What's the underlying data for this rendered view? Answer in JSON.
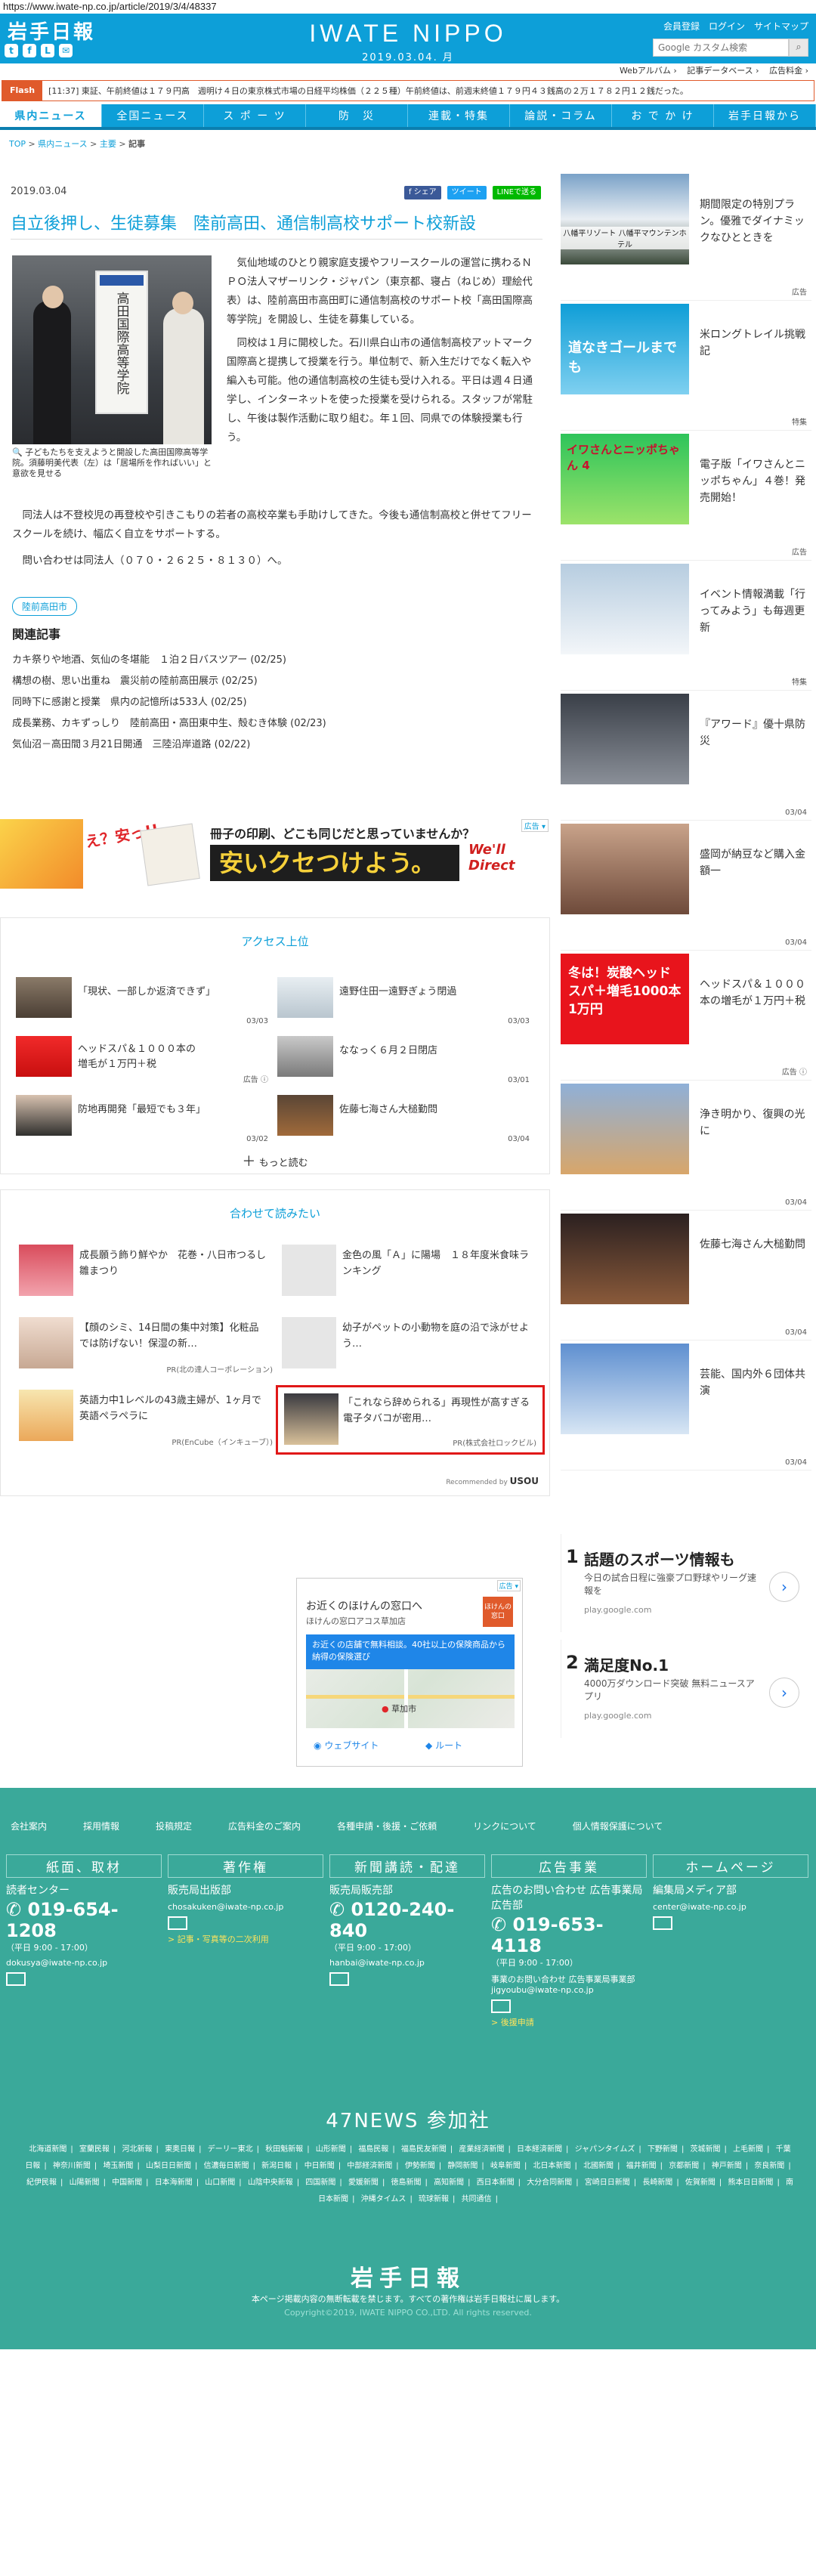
{
  "browser": {
    "url": "https://www.iwate-np.co.jp/article/2019/3/4/48337"
  },
  "header": {
    "logo_jp": "岩手日報",
    "brand_en": "IWATE NIPPO",
    "date": "2019.03.04. 月",
    "links": [
      "会員登録",
      "ログイン",
      "サイトマップ"
    ],
    "search_placeholder": "Google カスタム検索",
    "sublinks": [
      "Webアルバム ›",
      "記事データベース ›",
      "広告料金 ›"
    ],
    "social": [
      "twitter-icon",
      "facebook-icon",
      "line-icon",
      "mail-icon"
    ]
  },
  "flash": {
    "tag": "Flash",
    "text": "[11:37] 東証、午前終値は１７９円高　週明け４日の東京株式市場の日経平均株価（２２５種）午前終値は、前週末終値１７９円４３銭高の２万１７８２円１２銭だった。"
  },
  "nav": [
    "県内ニュース",
    "全国ニュース",
    "ス ポ ー ツ",
    "防　災",
    "連載・特集",
    "論説・コラム",
    "お で か け",
    "岩手日報から"
  ],
  "breadcrumb": [
    "TOP",
    "県内ニュース",
    "主要",
    "記事"
  ],
  "article": {
    "date": "2019.03.04",
    "share": [
      "f シェア",
      "ツイート",
      "LINEで送る"
    ],
    "title": "自立後押し、生徒募集　陸前高田、通信制高校サポート校新設",
    "photo_sign": "高田国際高等学院",
    "caption": "子どもたちを支えようと開設した高田国際高等学院。須藤明美代表（左）は「居場所を作ればいい」と意欲を見せる",
    "p1": "気仙地域のひとり親家庭支援やフリースクールの運営に携わるＮＰＯ法人マザーリンク・ジャパン（東京都、寝占（ねじめ）理絵代表）は、陸前高田市高田町に通信制高校のサポート校「高田国際高等学院」を開設し、生徒を募集している。",
    "p2": "同校は１月に開校した。石川県白山市の通信制高校アットマーク国際高と提携して授業を行う。単位制で、新入生だけでなく転入や編入も可能。他の通信制高校の生徒も受け入れる。平日は週４日通学し、インターネットを使った授業を受けられる。スタッフが常駐し、午後は製作活動に取り組む。年１回、同県での体験授業も行う。",
    "p3": "同法人は不登校児の再登校や引きこもりの若者の高校卒業も手助けしてきた。今後も通信制高校と併せてフリースクールを続け、幅広く自立をサポートする。",
    "p4": "問い合わせは同法人（０７０・２６２５・８１３０）へ。",
    "tag": "陸前高田市",
    "related_title": "関連記事",
    "related": [
      "カキ祭りや地酒、気仙の冬堪能　１泊２日バスツアー (02/25)",
      "構想の樹、思い出重ね　震災前の陸前高田展示 (02/25)",
      "同時下に感謝と授業　県内の記憶所は533人 (02/25)",
      "成長業務、カキずっしり　陸前高田・高田東中生、殻むき体験 (02/23)",
      "気仙沼－高田間３月21日開通　三陸沿岸道路 (02/22)"
    ]
  },
  "ad_banner": {
    "label": "広告 ▾",
    "main": "安いクセつけよう。",
    "top": "冊子の印刷、どこも同じだと思っていませんか？",
    "left": "え？安っ!!",
    "brand": "We'll Direct"
  },
  "access": {
    "title": "アクセス上位",
    "items": [
      {
        "text": "「現状、一部しか返済できず」",
        "date": "03/03"
      },
      {
        "text": "遠野住田一遠野ぎょう閉過",
        "date": "03/03"
      },
      {
        "text": "ヘッドスパ＆１０００本の増毛が１万円＋税",
        "date": "広告 ⓘ"
      },
      {
        "text": "ななっく６月２日閉店",
        "date": "03/01"
      },
      {
        "text": "防地再開発「最短でも３年」",
        "date": "03/02"
      },
      {
        "text": "佐藤七海さん大槌勤問",
        "date": "03/04"
      }
    ],
    "more": "もっと読む"
  },
  "recommend": {
    "title": "合わせて読みたい",
    "items": [
      {
        "text": "成長願う飾り鮮やか　花巻・八日市つるし雛まつり",
        "source": ""
      },
      {
        "text": "金色の風「Ａ」に陽場　１８年度米食味ランキング",
        "source": ""
      },
      {
        "text": "【顔のシミ、14日間の集中対策】化粧品では防げない！保湿の新…",
        "source": "PR(北の達人コーポレーション)"
      },
      {
        "text": "幼子がペットの小動物を庭の沿で泳がせよう…",
        "source": ""
      },
      {
        "text": "英語力中1レベルの43歳主婦が、1ヶ月で英語ペラペラに",
        "source": "PR(EnCube（インキューブ）)"
      },
      {
        "text": "「これなら辞められる」再現性が高すぎる電子タバコが密用…",
        "source": "PR(株式会社ロックビル)"
      }
    ],
    "footer": "Recommended by ",
    "footer_brand": "USOU"
  },
  "map_ad": {
    "label": "広告 ▾",
    "title": "お近くのほけんの窓口へ",
    "sub": "ほけんの窓口アコス草加店",
    "banner": "お近くの店舗で無料相談。40社以上の保険商品から納得の保険選び",
    "place": "草加市",
    "btn1": "ウェブサイト",
    "btn2": "ルート",
    "badge": "ほけんの窓口"
  },
  "side": {
    "items": [
      {
        "text": "期間限定の特別プラン。優雅でダイナミックなひとときを",
        "meta": "広告",
        "thumb": "八幡平リゾート 八幡平マウンテンホテル"
      },
      {
        "text": "米ロングトレイル挑戦記",
        "meta": "特集",
        "thumb": "道なきゴールまでも"
      },
      {
        "text": "電子版「イワさんとニッポちゃん」４巻！発売開始！",
        "meta": "広告",
        "thumb": "イワさんとニッポちゃん 4"
      },
      {
        "text": "イベント情報満載「行ってみよう」も毎週更新",
        "meta": "特集",
        "thumb": ""
      },
      {
        "text": "『アワード』優十県防災",
        "meta": "03/04",
        "thumb": ""
      },
      {
        "text": "盛岡が納豆など購入金額一",
        "meta": "03/04",
        "thumb": ""
      },
      {
        "text": "ヘッドスパ＆１０００本の増毛が１万円＋税",
        "meta": "広告 ⓘ",
        "thumb": "冬は！炭酸ヘッドスパ＋増毛1000本 1万円"
      },
      {
        "text": "浄き明かり、復興の光に",
        "meta": "03/04",
        "thumb": ""
      },
      {
        "text": "佐藤七海さん大槌勤問",
        "meta": "03/04",
        "thumb": ""
      },
      {
        "text": "芸能、国内外６団体共演",
        "meta": "03/04",
        "thumb": ""
      }
    ],
    "gads": [
      {
        "num": "1",
        "title": "話題のスポーツ情報も",
        "desc": "今日の試合日程に強豪プロ野球やリーグ速報を",
        "url": "play.google.com"
      },
      {
        "num": "2",
        "title": "満足度No.1",
        "desc": "4000万ダウンロード突破 無料ニュースアプリ",
        "url": "play.google.com"
      }
    ]
  },
  "footer": {
    "links": [
      "会社案内",
      "採用情報",
      "投稿規定",
      "広告料金のご案内",
      "各種申請・後援・ご依頼",
      "リンクについて",
      "個人情報保護について"
    ],
    "cols": [
      {
        "head": "紙面、取材",
        "sub": "読者センター",
        "tel": "019-654-1208",
        "hours": "（平日 9:00 - 17:00）",
        "mail": "dokusya@iwate-np.co.jp",
        "link": ""
      },
      {
        "head": "著作権",
        "sub": "販売局出版部",
        "tel": "",
        "hours": "",
        "mail": "chosakuken@iwate-np.co.jp",
        "link": "> 記事・写真等の二次利用"
      },
      {
        "head": "新聞講読・配達",
        "sub": "販売局販売部",
        "tel": "0120-240-840",
        "hours": "（平日 9:00 - 17:00）",
        "mail": "hanbai@iwate-np.co.jp",
        "link": ""
      },
      {
        "head": "広告事業",
        "sub": "広告のお問い合わせ 広告事業局広告部",
        "tel": "019-653-4118",
        "hours": "（平日 9:00 - 17:00）",
        "mail": "事業のお問い合わせ 広告事業局事業部 jigyoubu@iwate-np.co.jp",
        "link": "> 後援申請"
      },
      {
        "head": "ホームページ",
        "sub": "編集局メディア部",
        "tel": "",
        "hours": "",
        "mail": "center@iwate-np.co.jp",
        "link": ""
      }
    ],
    "news47": "47NEWS 参加社",
    "papers": [
      "北海道新聞",
      "室蘭民報",
      "河北新報",
      "東奥日報",
      "デーリー東北",
      "秋田魁新報",
      "山形新聞",
      "福島民報",
      "福島民友新聞",
      "産業経済新聞",
      "日本経済新聞",
      "ジャパンタイムズ",
      "下野新聞",
      "茨城新聞",
      "上毛新聞",
      "千葉日報",
      "神奈川新聞",
      "埼玉新聞",
      "山梨日日新聞",
      "信濃毎日新聞",
      "新潟日報",
      "中日新聞",
      "中部経済新聞",
      "伊勢新聞",
      "静岡新聞",
      "岐阜新聞",
      "北日本新聞",
      "北國新聞",
      "福井新聞",
      "京都新聞",
      "神戸新聞",
      "奈良新聞",
      "紀伊民報",
      "山陽新聞",
      "中国新聞",
      "日本海新聞",
      "山口新聞",
      "山陰中央新報",
      "四国新聞",
      "愛媛新聞",
      "徳島新聞",
      "高知新聞",
      "西日本新聞",
      "大分合同新聞",
      "宮崎日日新聞",
      "長崎新聞",
      "佐賀新聞",
      "熊本日日新聞",
      "南日本新聞",
      "沖縄タイムス",
      "琉球新報",
      "共同通信"
    ],
    "logo": "岩手日報",
    "note": "本ページ掲載内容の無断転載を禁じます。すべての著作権は岩手日報社に属します。",
    "copyright": "Copyright©2019, IWATE NIPPO CO.,LTD. All rights reserved."
  },
  "colors": {
    "brand": "#0d9fd8",
    "footer": "#3aa99a",
    "flash": "#e05a2b",
    "highlight": "#e01818"
  }
}
